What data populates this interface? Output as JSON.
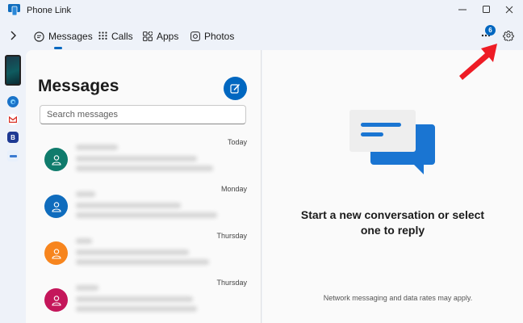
{
  "window": {
    "title": "Phone Link"
  },
  "nav": {
    "tabs": [
      {
        "label": "Messages",
        "icon": "message-icon"
      },
      {
        "label": "Calls",
        "icon": "dialpad-icon"
      },
      {
        "label": "Apps",
        "icon": "apps-icon"
      },
      {
        "label": "Photos",
        "icon": "photos-icon"
      }
    ],
    "active_tab": "Messages",
    "notification_count": "6"
  },
  "rail": {
    "apps": [
      {
        "icon": "edge-app-icon",
        "color": "#1a73c9"
      },
      {
        "icon": "gmail-app-icon",
        "color": "#ffffff"
      },
      {
        "icon": "b-app-icon",
        "color": "#1f3a93"
      },
      {
        "icon": "small-app-icon",
        "color": "#e8f0fb"
      }
    ]
  },
  "messages": {
    "heading": "Messages",
    "search_placeholder": "Search messages",
    "conversations": [
      {
        "time": "Today",
        "avatar_color": "#0f7b6c"
      },
      {
        "time": "Monday",
        "avatar_color": "#0f6cbd"
      },
      {
        "time": "Thursday",
        "avatar_color": "#f7851e"
      },
      {
        "time": "Thursday",
        "avatar_color": "#c4165a"
      }
    ]
  },
  "empty_state": {
    "line1": "Start a new conversation or select",
    "line2": "one to reply",
    "footnote": "Network messaging and data rates may apply."
  },
  "colors": {
    "accent": "#0067c0",
    "annotation": "#ee1c25"
  }
}
